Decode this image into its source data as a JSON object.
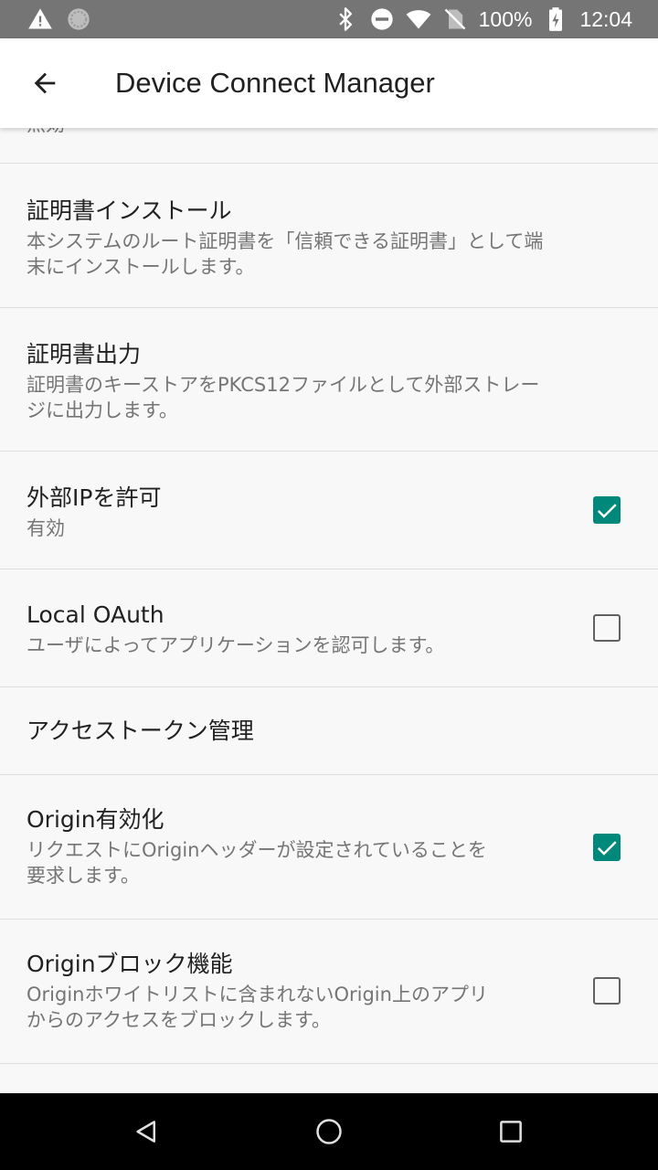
{
  "status_bar": {
    "battery": "100%",
    "time": "12:04",
    "icons": [
      "warning-icon",
      "sync-icon",
      "bluetooth-icon",
      "dnd-icon",
      "wifi-icon",
      "no-sim-icon",
      "battery-charging-icon"
    ]
  },
  "app_bar": {
    "title": "Device Connect Manager",
    "back_icon": "arrow-back-icon"
  },
  "list": {
    "partial_summary": "無効",
    "items": [
      {
        "title": "証明書インストール",
        "summary_line1": "本システムのルート証明書を「信頼できる証明書」として端",
        "summary_line2": "末にインストールします。"
      },
      {
        "title": "証明書出力",
        "summary_line1": "証明書のキーストアをPKCS12ファイルとして外部ストレー",
        "summary_line2": "ジに出力します。"
      },
      {
        "title": "外部IPを許可",
        "summary_line1": "有効",
        "checked": true
      },
      {
        "title": "Local OAuth",
        "summary_line1": "ユーザによってアプリケーションを認可します。",
        "checked": false
      },
      {
        "title": "アクセストークン管理"
      },
      {
        "title": "Origin有効化",
        "summary_line1": "リクエストにOriginヘッダーが設定されていることを",
        "summary_line2": "要求します。",
        "checked": true
      },
      {
        "title": "Originブロック機能",
        "summary_line1": "Originホワイトリストに含まれないOrigin上のアプリ",
        "summary_line2": "からのアクセスをブロックします。",
        "checked": false
      }
    ]
  },
  "nav_bar": {
    "icons": [
      "nav-back-icon",
      "nav-home-icon",
      "nav-recents-icon"
    ]
  },
  "colors": {
    "accent": "#00897b",
    "status_bar": "#757575",
    "app_bar": "#ffffff",
    "background": "#f8f8f8"
  }
}
